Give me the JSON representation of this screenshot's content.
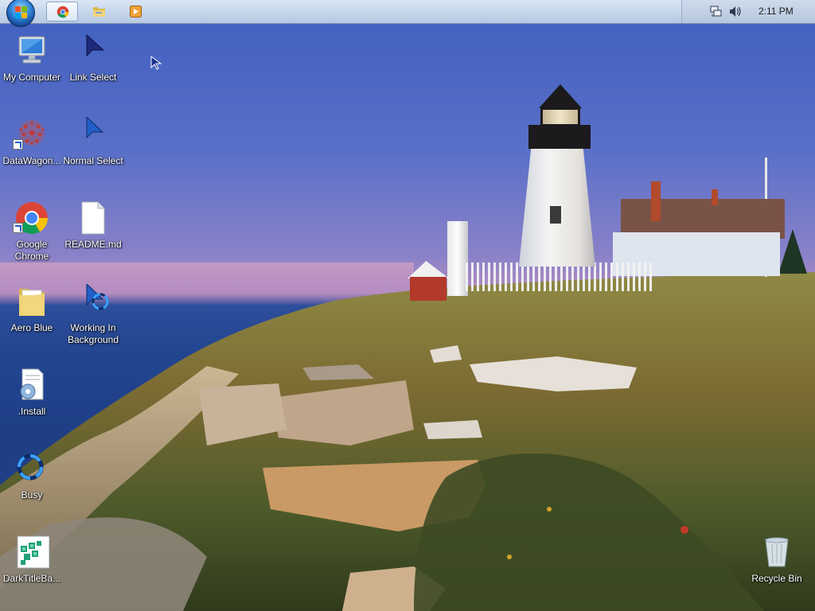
{
  "taskbar": {
    "clock": "2:11 PM",
    "buttons": [
      {
        "name": "chrome-taskbar-button",
        "icon": "chrome-icon",
        "active": true
      },
      {
        "name": "explorer-taskbar-button",
        "icon": "folder-icon",
        "active": false
      },
      {
        "name": "media-player-taskbar-button",
        "icon": "media-player-icon",
        "active": false
      }
    ],
    "tray_icons": [
      "network-icon",
      "volume-icon"
    ]
  },
  "desktop": {
    "icons": [
      {
        "label": "My Computer",
        "icon": "computer-icon"
      },
      {
        "label": "Link Select",
        "icon": "cursor-arrow-icon"
      },
      {
        "label": "DataWagon...",
        "icon": "datawagon-icon"
      },
      {
        "label": "Normal Select",
        "icon": "cursor-arrow-icon"
      },
      {
        "label": "Google Chrome",
        "icon": "chrome-icon"
      },
      {
        "label": "README.md",
        "icon": "document-icon"
      },
      {
        "label": "Aero Blue",
        "icon": "folder-icon"
      },
      {
        "label": "Working In Background",
        "icon": "busy-cursor-icon"
      },
      {
        "label": ".Install",
        "icon": "install-icon"
      },
      {
        "label": "Busy",
        "icon": "busy-cursor-icon"
      },
      {
        "label": "DarkTitleBa...",
        "icon": "dark-title-bar-icon"
      },
      {
        "label": "Recycle Bin",
        "icon": "recycle-bin-icon"
      }
    ]
  },
  "colors": {
    "taskbar": "#c6d6ec",
    "sky": "#4a66c4",
    "sea": "#224590"
  }
}
